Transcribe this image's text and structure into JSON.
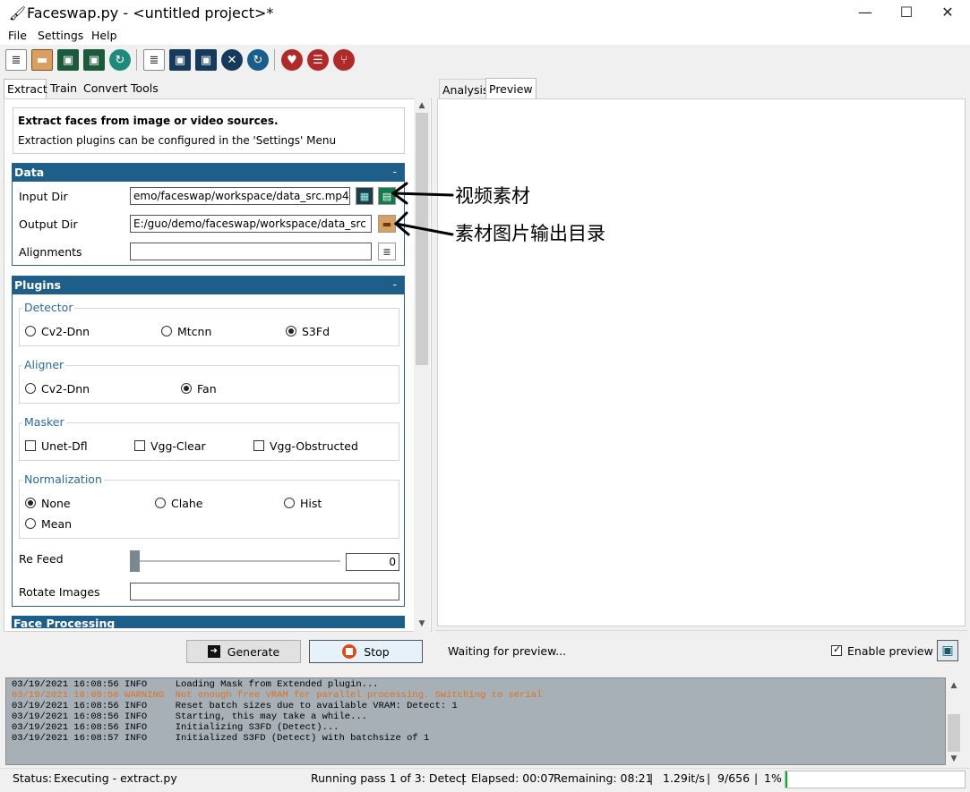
{
  "window": {
    "title": "Faceswap.py - <untitled project>*",
    "min_glyph": "—",
    "max_glyph": "☐",
    "close_glyph": "✕"
  },
  "menu": {
    "file": "File",
    "settings": "Settings",
    "help": "Help"
  },
  "toolbar": {
    "icons": [
      "new-config-icon",
      "open-folder-icon",
      "save-icon",
      "save-as-icon",
      "reload-icon",
      "new-project-icon",
      "save-project-icon",
      "save-project-as-icon",
      "close-icon",
      "refresh-icon",
      "donate-icon",
      "command-list-icon",
      "git-update-icon"
    ],
    "accent": "#1e5f8a"
  },
  "tabs": {
    "extract": "Extract",
    "train": "Train",
    "convert": "Convert",
    "tools": "Tools"
  },
  "description": {
    "title": "Extract faces from image or video sources.",
    "subtitle": "Extraction plugins can be configured in the 'Settings' Menu"
  },
  "data_section": {
    "header": "Data",
    "collapse": "-",
    "input_dir_label": "Input Dir",
    "input_dir_value": "emo/faceswap/workspace/data_src.mp4",
    "output_dir_label": "Output Dir",
    "output_dir_value": "E:/guo/demo/faceswap/workspace/data_src",
    "alignments_label": "Alignments",
    "alignments_value": ""
  },
  "plugins_section": {
    "header": "Plugins",
    "collapse": "-",
    "detector": {
      "title": "Detector",
      "options": [
        "Cv2-Dnn",
        "Mtcnn",
        "S3Fd"
      ],
      "selected": "S3Fd"
    },
    "aligner": {
      "title": "Aligner",
      "options": [
        "Cv2-Dnn",
        "Fan"
      ],
      "selected": "Fan"
    },
    "masker": {
      "title": "Masker",
      "options": [
        "Unet-Dfl",
        "Vgg-Clear",
        "Vgg-Obstructed"
      ]
    },
    "normalization": {
      "title": "Normalization",
      "options": [
        "None",
        "Clahe",
        "Hist",
        "Mean"
      ],
      "selected": "None"
    },
    "re_feed_label": "Re Feed",
    "re_feed_value": "0",
    "rotate_label": "Rotate Images",
    "rotate_value": ""
  },
  "face_processing_header": "Face Processing",
  "buttons": {
    "generate": "Generate",
    "stop": "Stop"
  },
  "right_tabs": {
    "analysis": "Analysis",
    "preview": "Preview"
  },
  "preview": {
    "status": "Waiting for preview...",
    "enable_label": "Enable preview",
    "enabled": true
  },
  "annotations": {
    "input": "视频素材",
    "output": "素材图片输出目录"
  },
  "console": {
    "lines": [
      {
        "time": "03/19/2021 16:08:56",
        "level": "INFO",
        "msg": "Loading Mask from Extended plugin...",
        "color": "#000000"
      },
      {
        "time": "03/19/2021 16:08:56",
        "level": "WARNING",
        "msg": "Not enough free VRAM for parallel processing. Switching to serial",
        "color": "#e07020"
      },
      {
        "time": "03/19/2021 16:08:56",
        "level": "INFO",
        "msg": "Reset batch sizes due to available VRAM: Detect: 1",
        "color": "#000000"
      },
      {
        "time": "03/19/2021 16:08:56",
        "level": "INFO",
        "msg": "Starting, this may take a while...",
        "color": "#000000"
      },
      {
        "time": "03/19/2021 16:08:56",
        "level": "INFO",
        "msg": "Initializing S3FD (Detect)...",
        "color": "#000000"
      },
      {
        "time": "03/19/2021 16:08:57",
        "level": "INFO",
        "msg": "Initialized S3FD (Detect) with batchsize of 1",
        "color": "#000000"
      }
    ]
  },
  "status": {
    "label": "Status:",
    "value": "Executing - extract.py",
    "pass": "Running pass 1 of 3: Detect",
    "elapsed": "Elapsed: 00:07",
    "remaining": "Remaining: 08:21",
    "rate": "1.29it/s",
    "count": "9/656",
    "percent": "1%",
    "progress": 0.01
  },
  "separator": "|"
}
